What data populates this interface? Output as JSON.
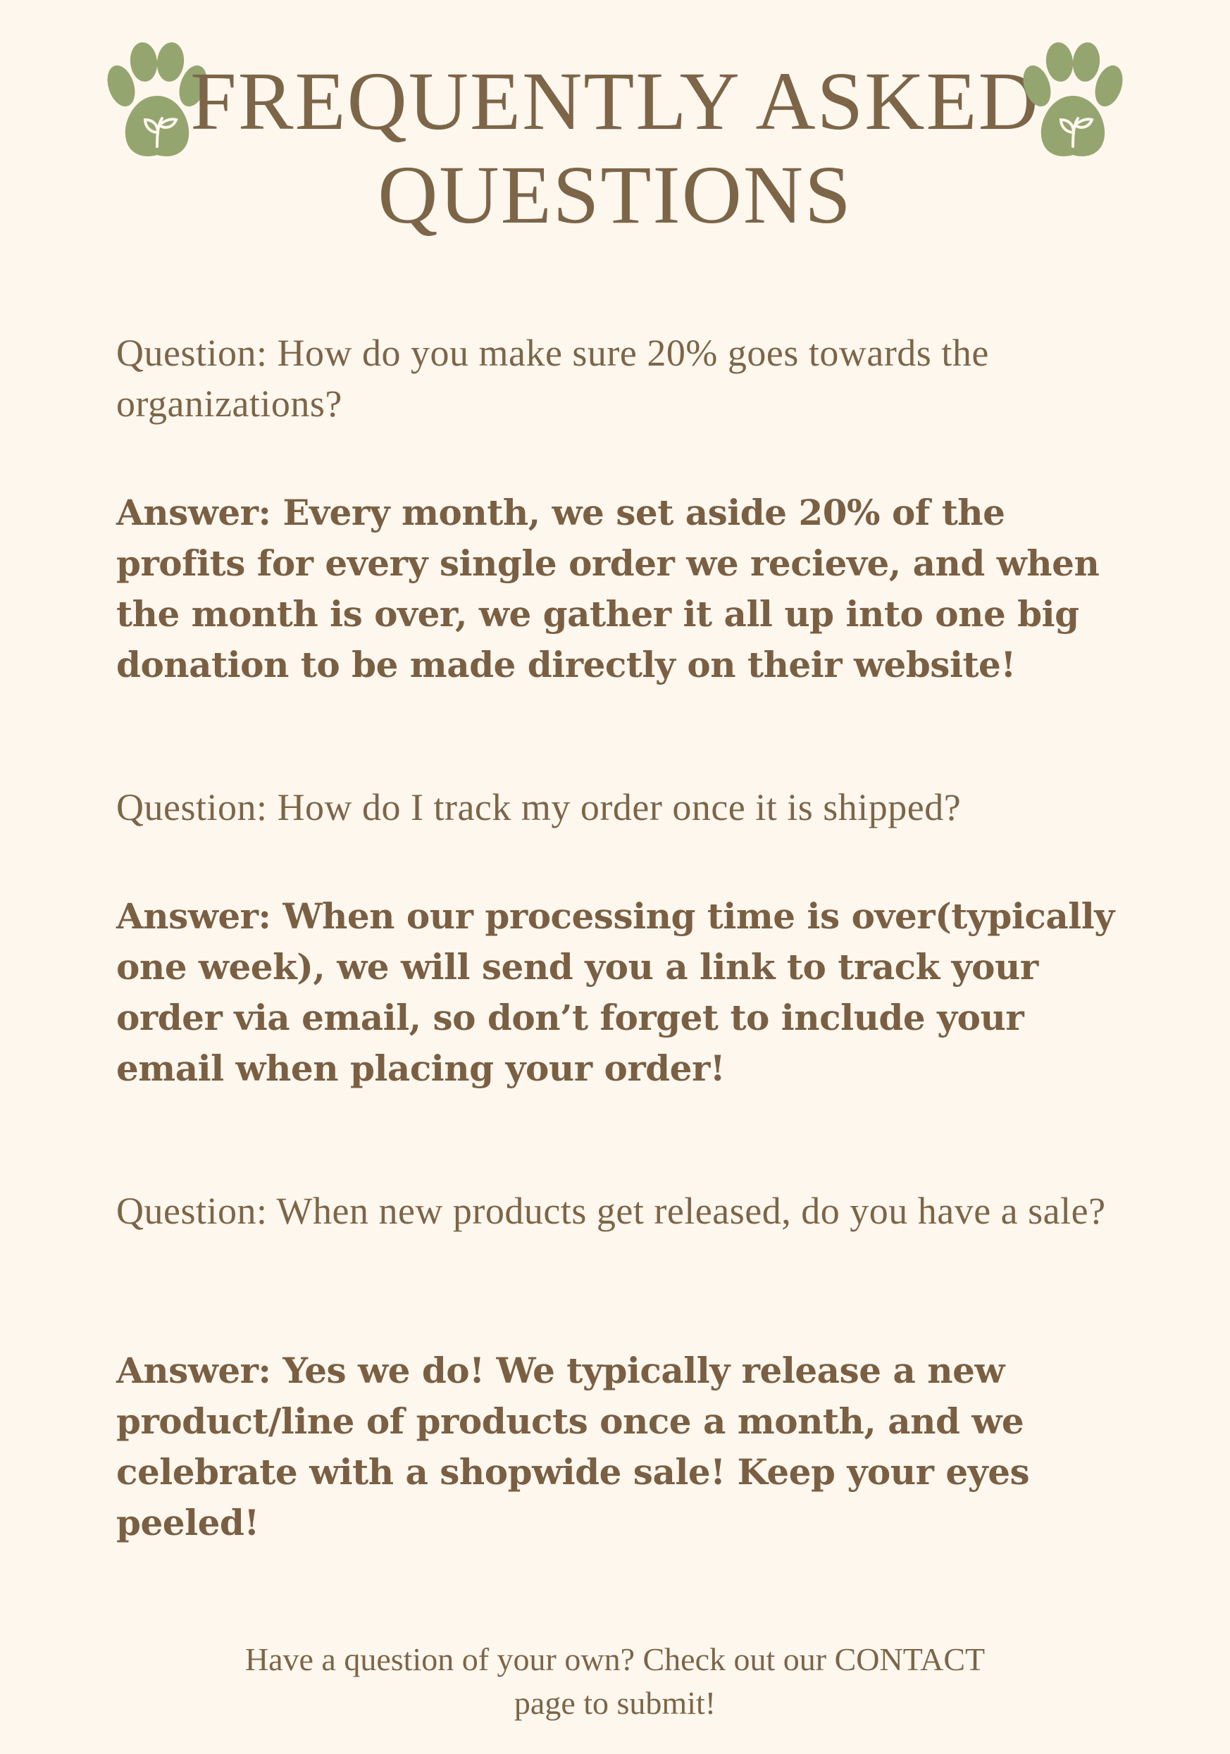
{
  "header": {
    "title_line1": "FREQUENTLY ASKED",
    "title_line2": "QUESTIONS",
    "icon": "paw-leaf-icon",
    "icon_color": "#95a570",
    "title_color": "#7d6548"
  },
  "faq": [
    {
      "question": "Question: How do you make sure 20% goes towards the organizations?",
      "answer": "Answer: Every month, we set aside 20% of the profits for every single order we recieve, and when the month is over, we gather it all up into one big donation to be made directly on their website!"
    },
    {
      "question": "Question: How do I track my order once it is shipped?",
      "answer": "Answer: When our processing time is over(typically one week), we will send you a link to track your order via email, so don’t forget to include your email when placing your order!"
    },
    {
      "question": "Question: When new products get released, do you have a sale?",
      "answer": "Answer: Yes we do! We typically release a new product/line of products once a month, and we celebrate with a shopwide sale! Keep your eyes peeled!"
    }
  ],
  "footer": {
    "line1": "Have a question of your own? Check out our CONTACT",
    "line2": "page to submit!"
  },
  "colors": {
    "background": "#fdf7ee",
    "text": "#7d6548"
  }
}
